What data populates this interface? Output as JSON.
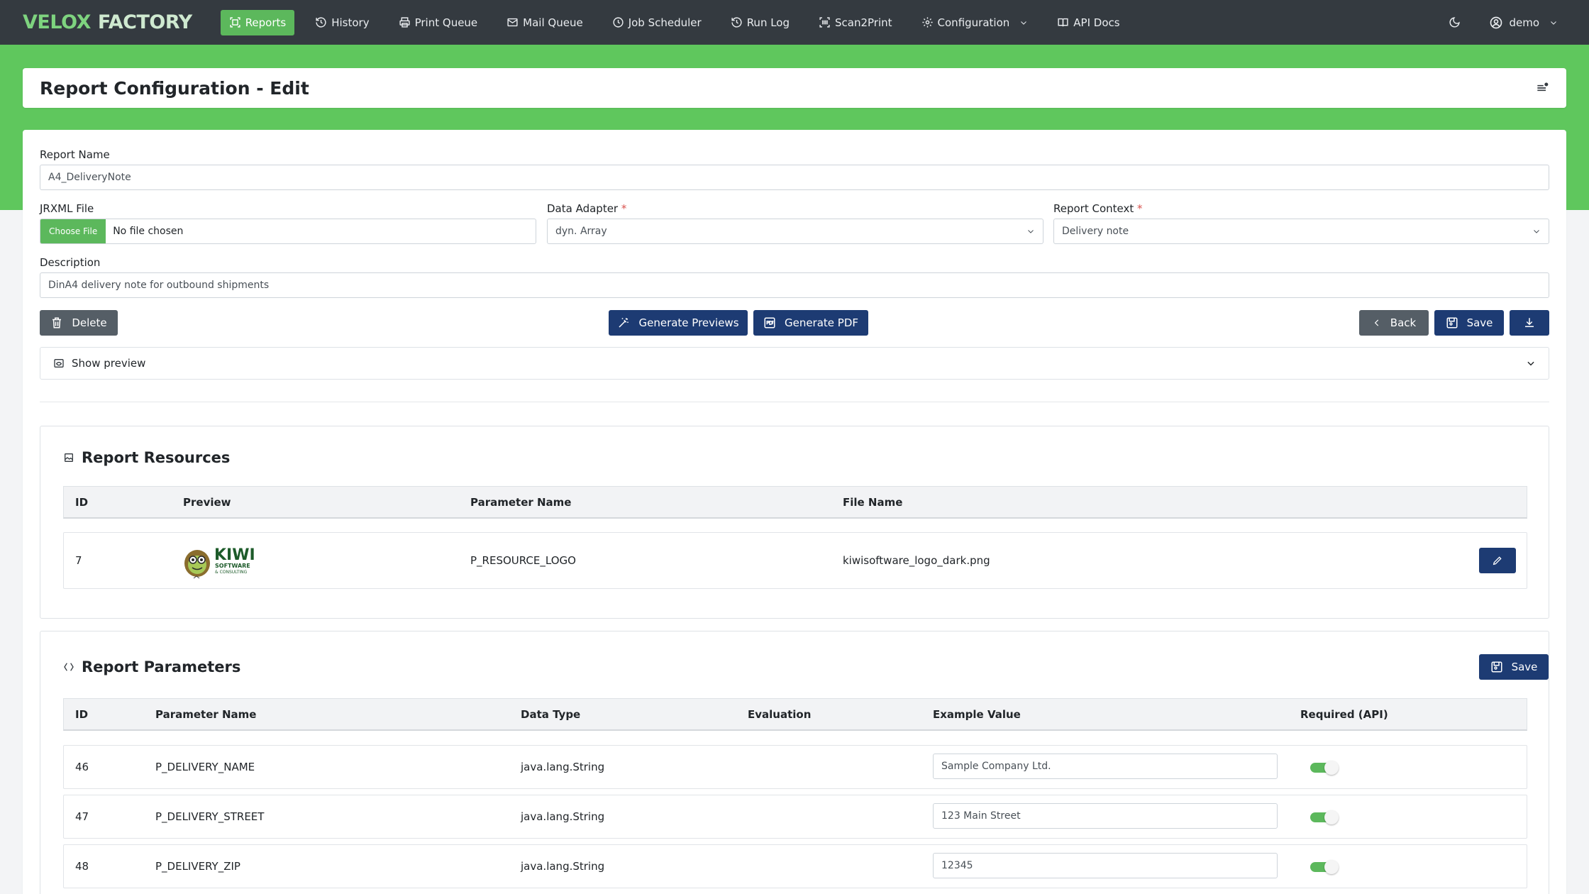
{
  "brand": {
    "part1": "VELOX",
    "part2": "FACTORY"
  },
  "nav": {
    "items": [
      {
        "label": "Reports",
        "icon": "scan-icon",
        "active": true
      },
      {
        "label": "History",
        "icon": "history-icon"
      },
      {
        "label": "Print Queue",
        "icon": "printer-icon"
      },
      {
        "label": "Mail Queue",
        "icon": "mail-icon"
      },
      {
        "label": "Job Scheduler",
        "icon": "clock-icon"
      },
      {
        "label": "Run Log",
        "icon": "history-icon"
      },
      {
        "label": "Scan2Print",
        "icon": "barcode-icon"
      },
      {
        "label": "Configuration",
        "icon": "gear-icon",
        "dropdown": true
      },
      {
        "label": "API Docs",
        "icon": "book-icon"
      }
    ],
    "user": "demo",
    "theme_icon": "moon-icon"
  },
  "page": {
    "title": "Report Configuration - Edit"
  },
  "form": {
    "report_name_label": "Report Name",
    "report_name_value": "A4_DeliveryNote",
    "jrxml_label": "JRXML File",
    "choose_file": "Choose File",
    "no_file": "No file chosen",
    "data_adapter_label": "Data Adapter",
    "data_adapter_value": "dyn. Array",
    "report_context_label": "Report Context",
    "report_context_value": "Delivery note",
    "required_mark": "*",
    "description_label": "Description",
    "description_value": "DinA4 delivery note for outbound shipments"
  },
  "actions": {
    "delete": "Delete",
    "generate_previews": "Generate Previews",
    "generate_pdf": "Generate PDF",
    "back": "Back",
    "save": "Save"
  },
  "preview": {
    "label": "Show preview"
  },
  "resources": {
    "title": "Report Resources",
    "headers": [
      "ID",
      "Preview",
      "Parameter Name",
      "File Name"
    ],
    "rows": [
      {
        "id": "7",
        "logo_text": "KIWI",
        "logo_sub1": "SOFTWARE",
        "logo_sub2": "& CONSULTING",
        "param": "P_RESOURCE_LOGO",
        "file": "kiwisoftware_logo_dark.png"
      }
    ]
  },
  "parameters": {
    "title": "Report Parameters",
    "save": "Save",
    "headers": [
      "ID",
      "Parameter Name",
      "Data Type",
      "Evaluation",
      "Example Value",
      "Required (API)"
    ],
    "rows": [
      {
        "id": "46",
        "name": "P_DELIVERY_NAME",
        "type": "java.lang.String",
        "evaluation": "",
        "example": "Sample Company Ltd.",
        "required": true
      },
      {
        "id": "47",
        "name": "P_DELIVERY_STREET",
        "type": "java.lang.String",
        "evaluation": "",
        "example": "123 Main Street",
        "required": true
      },
      {
        "id": "48",
        "name": "P_DELIVERY_ZIP",
        "type": "java.lang.String",
        "evaluation": "",
        "example": "12345",
        "required": true
      }
    ]
  },
  "colors": {
    "navbar": "#343a40",
    "green": "#5fc75d",
    "active_nav": "#5cb85c",
    "navy": "#1d3b73",
    "gray_button": "#555e66"
  }
}
